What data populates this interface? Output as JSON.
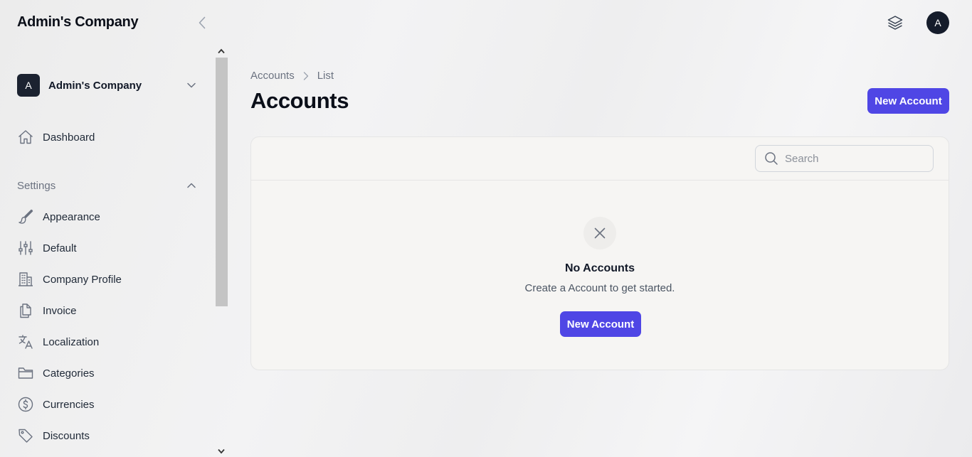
{
  "sidebar": {
    "brand": "Admin's Company",
    "company": {
      "avatar": "A",
      "name": "Admin's Company"
    },
    "dashboard": {
      "label": "Dashboard",
      "icon": "home-icon"
    },
    "settings": {
      "label": "Settings",
      "items": [
        {
          "label": "Appearance",
          "icon": "paintbrush-icon"
        },
        {
          "label": "Default",
          "icon": "sliders-icon"
        },
        {
          "label": "Company Profile",
          "icon": "building-icon"
        },
        {
          "label": "Invoice",
          "icon": "documents-icon"
        },
        {
          "label": "Localization",
          "icon": "language-icon"
        },
        {
          "label": "Categories",
          "icon": "folder-icon"
        },
        {
          "label": "Currencies",
          "icon": "dollar-circle-icon"
        },
        {
          "label": "Discounts",
          "icon": "tag-icon"
        }
      ]
    }
  },
  "topbar": {
    "user_initial": "A",
    "layers_icon": "layers-icon"
  },
  "main": {
    "breadcrumb": [
      "Accounts",
      "List"
    ],
    "title": "Accounts",
    "new_button": "New Account",
    "search": {
      "placeholder": "Search",
      "value": ""
    },
    "empty": {
      "title": "No Accounts",
      "description": "Create a Account to get started.",
      "button": "New Account"
    }
  },
  "colors": {
    "primary": "#4f46e5",
    "avatar": "#151c2b"
  }
}
